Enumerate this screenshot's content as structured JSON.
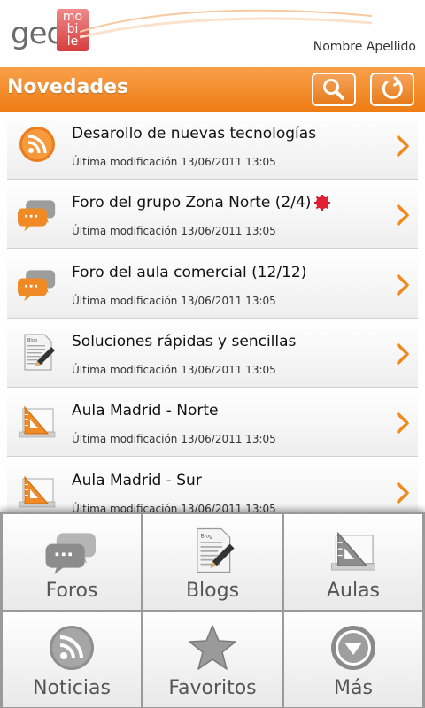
{
  "header": {
    "logo_gec": "gec",
    "logo_mobile": "mobile",
    "user_name": "Nombre Apellido"
  },
  "titlebar": {
    "title": "Novedades",
    "search_icon": "search-icon",
    "refresh_icon": "refresh-icon",
    "accent": "#ee7d14"
  },
  "items": [
    {
      "title": "Desarollo de nuevas tecnologías",
      "subtitle": "Última modificación 13/06/2011  13:05",
      "icon": "rss-icon",
      "badge": false
    },
    {
      "title": "Foro del grupo Zona Norte (2/4)",
      "subtitle": "Última modificación 13/06/2011  13:05",
      "icon": "chat-bubbles-icon",
      "badge": true
    },
    {
      "title": "Foro del aula comercial (12/12)",
      "subtitle": "Última modificación 13/06/2011  13:05",
      "icon": "chat-bubbles-icon",
      "badge": false
    },
    {
      "title": "Soluciones rápidas y sencillas",
      "subtitle": "Última modificación 13/06/2011  13:05",
      "icon": "blog-document-icon",
      "badge": false
    },
    {
      "title": "Aula Madrid - Norte",
      "subtitle": "Última modificación 13/06/2011  13:05",
      "icon": "classroom-triangle-icon",
      "badge": false
    },
    {
      "title": "Aula Madrid - Sur",
      "subtitle": "Última modificación 13/06/2011  13:05",
      "icon": "classroom-triangle-icon",
      "badge": false
    }
  ],
  "menu": [
    {
      "label": "Foros",
      "icon": "chat-bubbles-icon"
    },
    {
      "label": "Blogs",
      "icon": "blog-document-icon"
    },
    {
      "label": "Aulas",
      "icon": "classroom-triangle-icon"
    },
    {
      "label": "Noticias",
      "icon": "rss-icon"
    },
    {
      "label": "Favoritos",
      "icon": "star-icon"
    },
    {
      "label": "Más",
      "icon": "more-arrow-icon"
    }
  ]
}
